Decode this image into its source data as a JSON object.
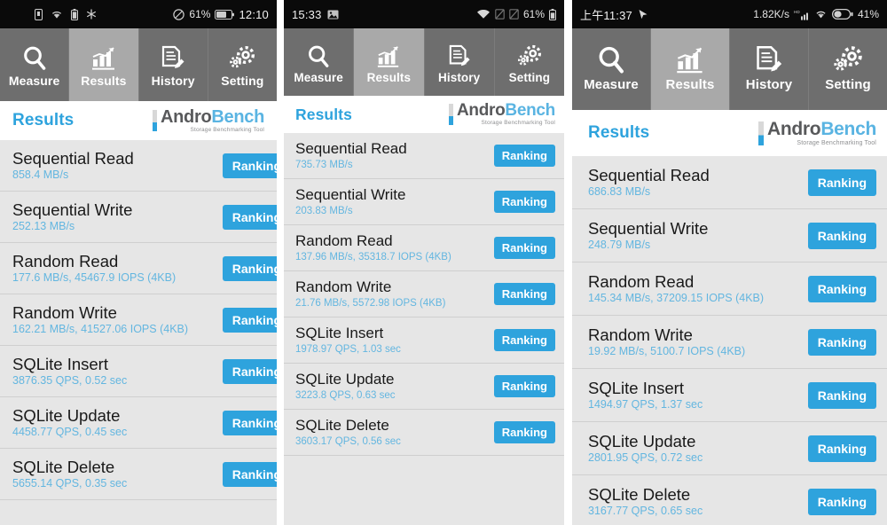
{
  "app": {
    "logo_main_dark": "Andro",
    "logo_main_light": "Bench",
    "logo_tagline": "Storage Benchmarking Tool",
    "section_title": "Results",
    "ranking_label": "Ranking",
    "accent_color": "#2ea3dd",
    "value_color": "#63b6e0",
    "navbar_color": "#6e6e6e",
    "navbar_active_color": "#a9a9a9",
    "row_bg_color": "#e6e6e6"
  },
  "nav": {
    "tabs": [
      {
        "label": "Measure",
        "icon": "magnifier-icon",
        "active": false
      },
      {
        "label": "Results",
        "icon": "bar-chart-icon",
        "active": true
      },
      {
        "label": "History",
        "icon": "document-pencil-icon",
        "active": false
      },
      {
        "label": "Setting",
        "icon": "gears-icon",
        "active": false
      }
    ]
  },
  "panels": [
    {
      "id": "panel-1",
      "status": {
        "time": "12:10",
        "battery_percent": "61%",
        "left_icons": [
          "sim-card-icon",
          "wifi-icon",
          "battery-icon",
          "snowflake-icon"
        ],
        "right_icons": [
          "do-not-disturb-icon",
          "battery-icon"
        ]
      },
      "results": [
        {
          "name": "Sequential Read",
          "value": "858.4 MB/s"
        },
        {
          "name": "Sequential Write",
          "value": "252.13 MB/s"
        },
        {
          "name": "Random Read",
          "value": "177.6 MB/s, 45467.9 IOPS (4KB)"
        },
        {
          "name": "Random Write",
          "value": "162.21 MB/s, 41527.06 IOPS (4KB)"
        },
        {
          "name": "SQLite Insert",
          "value": "3876.35 QPS, 0.52 sec"
        },
        {
          "name": "SQLite Update",
          "value": "4458.77 QPS, 0.45 sec"
        },
        {
          "name": "SQLite Delete",
          "value": "5655.14 QPS, 0.35 sec"
        }
      ]
    },
    {
      "id": "panel-2",
      "status": {
        "time": "15:33",
        "battery_percent": "61%",
        "left_icons": [
          "image-icon"
        ],
        "right_icons": [
          "wifi-icon",
          "sim-off-icon",
          "sim-off-icon",
          "battery-icon"
        ]
      },
      "results": [
        {
          "name": "Sequential Read",
          "value": "735.73 MB/s"
        },
        {
          "name": "Sequential Write",
          "value": "203.83 MB/s"
        },
        {
          "name": "Random Read",
          "value": "137.96 MB/s, 35318.7 IOPS (4KB)"
        },
        {
          "name": "Random Write",
          "value": "21.76 MB/s, 5572.98 IOPS (4KB)"
        },
        {
          "name": "SQLite Insert",
          "value": "1978.97 QPS, 1.03 sec"
        },
        {
          "name": "SQLite Update",
          "value": "3223.8 QPS, 0.63 sec"
        },
        {
          "name": "SQLite Delete",
          "value": "3603.17 QPS, 0.56 sec"
        }
      ]
    },
    {
      "id": "panel-3",
      "status": {
        "time": "上午11:37",
        "network_speed": "1.82K/s",
        "battery_percent": "41%",
        "left_icons": [
          "cursor-icon"
        ],
        "right_icons": [
          "signal-hd-icon",
          "wifi-icon",
          "battery-icon"
        ]
      },
      "results": [
        {
          "name": "Sequential Read",
          "value": "686.83 MB/s"
        },
        {
          "name": "Sequential Write",
          "value": "248.79 MB/s"
        },
        {
          "name": "Random Read",
          "value": "145.34 MB/s, 37209.15 IOPS (4KB)"
        },
        {
          "name": "Random Write",
          "value": "19.92 MB/s, 5100.7 IOPS (4KB)"
        },
        {
          "name": "SQLite Insert",
          "value": "1494.97 QPS, 1.37 sec"
        },
        {
          "name": "SQLite Update",
          "value": "2801.95 QPS, 0.72 sec"
        },
        {
          "name": "SQLite Delete",
          "value": "3167.77 QPS, 0.65 sec"
        }
      ]
    }
  ]
}
